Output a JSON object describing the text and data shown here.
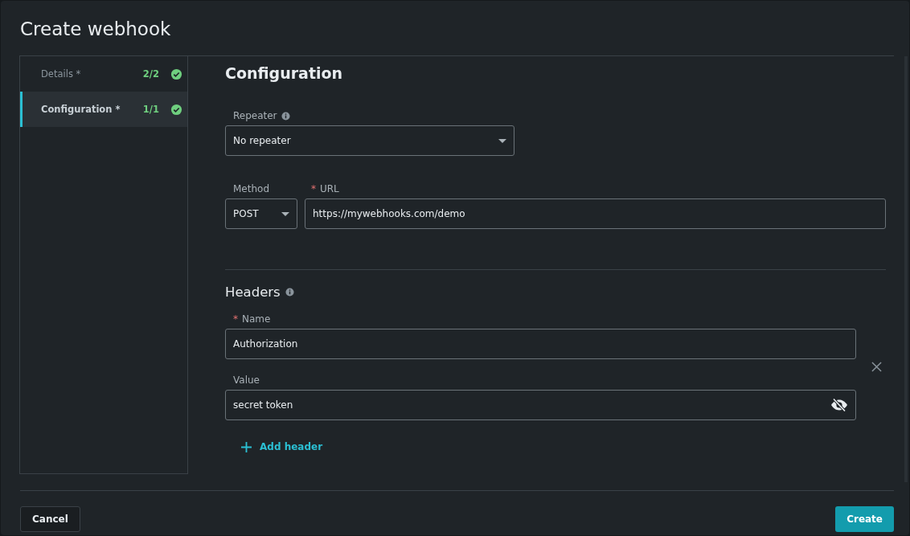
{
  "dialog": {
    "title": "Create webhook"
  },
  "steps": [
    {
      "label": "Details *",
      "count": "2/2",
      "complete": true,
      "selected": false
    },
    {
      "label": "Configuration *",
      "count": "1/1",
      "complete": true,
      "selected": true
    }
  ],
  "section_title": "Configuration",
  "repeater": {
    "label": "Repeater",
    "value": "No repeater"
  },
  "method": {
    "label": "Method",
    "value": "POST"
  },
  "url": {
    "required_mark": "*",
    "label": "URL",
    "value": "https://mywebhooks.com/demo"
  },
  "headers": {
    "title": "Headers",
    "items": [
      {
        "name_mark": "*",
        "name_label": "Name",
        "name": "Authorization",
        "value_label": "Value",
        "value": "secret token"
      }
    ],
    "add_label": "Add header"
  },
  "buttons": {
    "cancel": "Cancel",
    "create": "Create"
  }
}
